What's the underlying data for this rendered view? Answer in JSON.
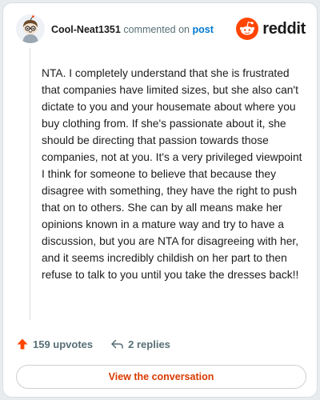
{
  "comment": {
    "username": "Cool-Neat1351",
    "action_text": "commented on",
    "post_link": "post",
    "body": "NTA. I completely understand that she is frustrated that companies have limited sizes, but she also can't dictate to you and your housemate about where you buy clothing from. If she's passionate about it, she should be directing that passion towards those companies, not at you. It's a very privileged viewpoint I think for someone to believe that because they disagree with something, they have the right to push that on to others. She can by all means make her opinions known in a mature way and try to have a discussion, but you are NTA for disagreeing with her, and it seems incredibly childish on her part to then refuse to talk to you until you take the dresses back!!"
  },
  "brand": {
    "wordmark": "reddit",
    "color": "#ff4500"
  },
  "actions": {
    "upvotes": "159 upvotes",
    "replies": "2 replies"
  },
  "cta": {
    "label": "View the conversation"
  },
  "icons": {
    "avatar": "snoo-avatar-icon",
    "logo": "reddit-logo-icon",
    "upvote": "upvote-arrow-icon",
    "reply": "reply-arrow-icon"
  }
}
